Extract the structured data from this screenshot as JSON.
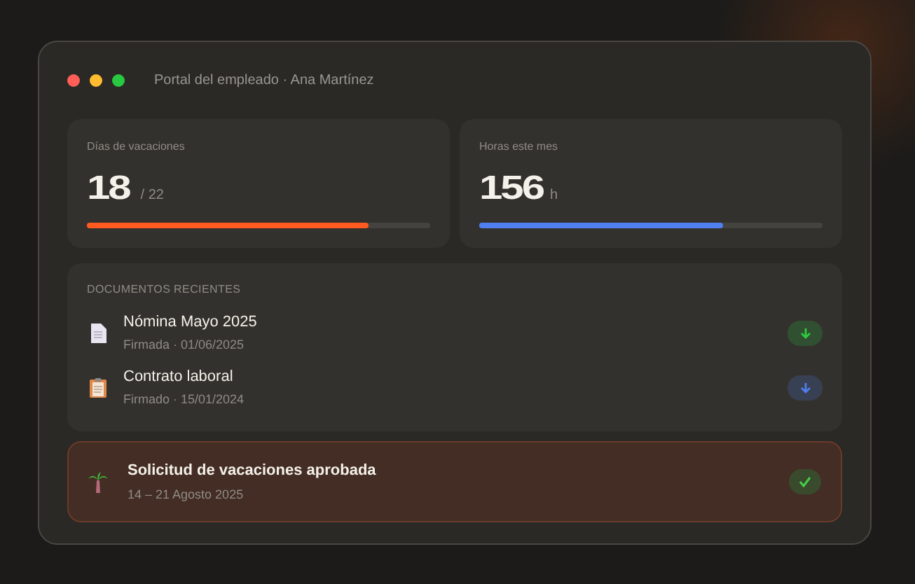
{
  "window": {
    "title": "Portal del empleado · Ana Martínez"
  },
  "stats": [
    {
      "label": "Días de vacaciones",
      "value": "18",
      "unit": "/ 22",
      "level": 0.82,
      "color": "#ff5a1f"
    },
    {
      "label": "Horas este mes",
      "value": "156",
      "unit": "h",
      "level": 0.71,
      "color": "#4f7ff0"
    }
  ],
  "documents": {
    "heading": "DOCUMENTOS RECIENTES",
    "items": [
      {
        "kind": "page",
        "title": "Nómina Mayo 2025",
        "meta": "Firmada · 01/06/2025",
        "color": "#2ecc40"
      },
      {
        "kind": "clipboard",
        "title": "Contrato laboral",
        "meta": "Firmado · 15/01/2024",
        "color": "#4f7ff0"
      }
    ]
  },
  "notice": {
    "title": "Solicitud de vacaciones aprobada",
    "subtitle": "14 – 21 Agosto 2025",
    "approved": true
  }
}
